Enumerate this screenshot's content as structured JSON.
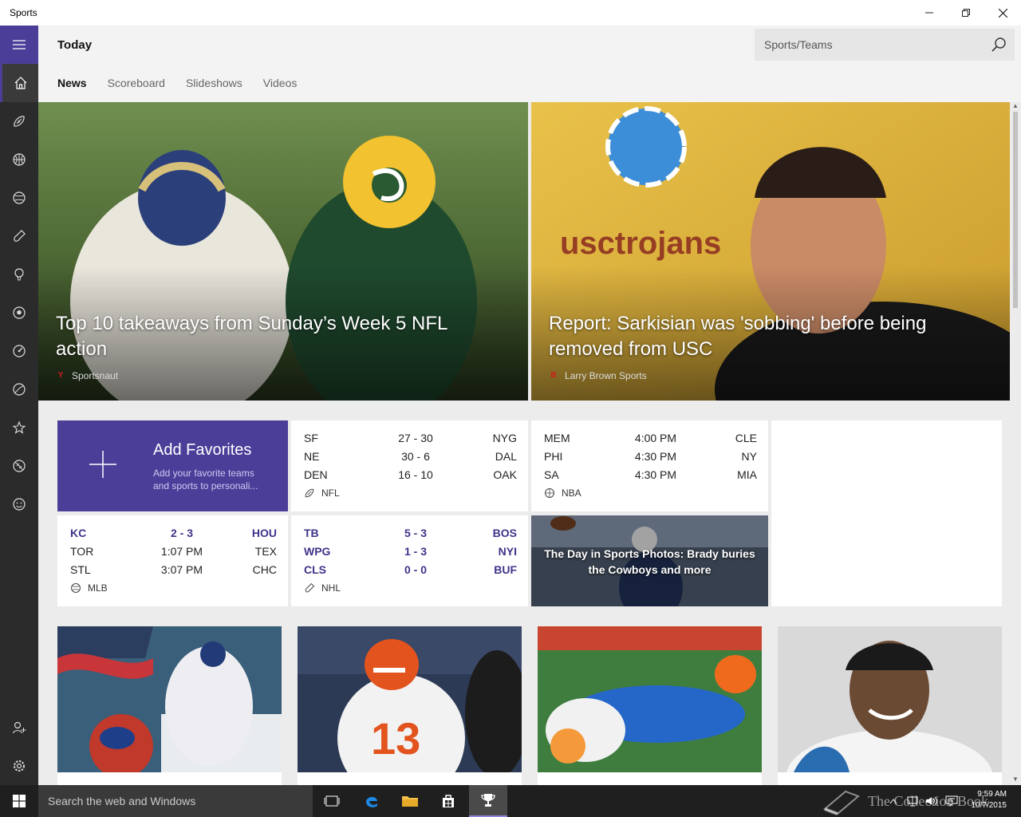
{
  "window": {
    "title": "Sports"
  },
  "header": {
    "page_title": "Today",
    "search_placeholder": "Sports/Teams",
    "tabs": [
      {
        "label": "News",
        "active": true
      },
      {
        "label": "Scoreboard",
        "active": false
      },
      {
        "label": "Slideshows",
        "active": false
      },
      {
        "label": "Videos",
        "active": false
      }
    ]
  },
  "rail": {
    "items": [
      "home-icon",
      "football-icon",
      "basketball-icon",
      "baseball-icon",
      "hockey-icon",
      "golf-icon",
      "soccer-icon",
      "racing-icon",
      "tennis-icon",
      "favorites-icon",
      "rugby-icon",
      "fantasy-icon"
    ],
    "bottom": [
      "add-person-icon",
      "gear-icon"
    ]
  },
  "heroes": [
    {
      "headline": "Top 10 takeaways from Sunday’s Week 5 NFL action",
      "source": "Sportsnaut",
      "source_logo": "Y"
    },
    {
      "headline": "Report: Sarkisian was 'sobbing' before being removed from USC",
      "source": "Larry Brown Sports",
      "source_logo": "B"
    }
  ],
  "favorites": {
    "title": "Add Favorites",
    "subtitle": "Add your favorite teams and sports to personali..."
  },
  "scores": {
    "nfl": {
      "league": "NFL",
      "games": [
        {
          "t1": "SF",
          "mid": "27  -  30",
          "t2": "NYG"
        },
        {
          "t1": "NE",
          "mid": "30  -  6",
          "t2": "DAL"
        },
        {
          "t1": "DEN",
          "mid": "16  -  10",
          "t2": "OAK"
        }
      ]
    },
    "nba": {
      "league": "NBA",
      "games": [
        {
          "t1": "MEM",
          "mid": "4:00 PM",
          "t2": "CLE"
        },
        {
          "t1": "PHI",
          "mid": "4:30 PM",
          "t2": "NY"
        },
        {
          "t1": "SA",
          "mid": "4:30 PM",
          "t2": "MIA"
        }
      ]
    },
    "mlb": {
      "league": "MLB",
      "games": [
        {
          "t1": "KC",
          "mid": "2  -  3",
          "t2": "HOU",
          "live": true
        },
        {
          "t1": "TOR",
          "mid": "1:07 PM",
          "t2": "TEX"
        },
        {
          "t1": "STL",
          "mid": "3:07 PM",
          "t2": "CHC"
        }
      ]
    },
    "nhl": {
      "league": "NHL",
      "games": [
        {
          "t1": "TB",
          "mid": "5  -  3",
          "t2": "BOS",
          "live": true
        },
        {
          "t1": "WPG",
          "mid": "1  -  3",
          "t2": "NYI",
          "live": true
        },
        {
          "t1": "CLS",
          "mid": "0  -  0",
          "t2": "BUF",
          "live": true
        }
      ]
    }
  },
  "photo_card": {
    "caption": "The Day in Sports Photos: Brady buries the Cowboys and more"
  },
  "taskbar": {
    "search_placeholder": "Search the web and Windows",
    "time": "9:59 AM",
    "date": "10/7/2015",
    "watermark": "The Collection Book"
  },
  "colors": {
    "accent": "#4b3e99",
    "rail": "#2b2b2b",
    "live_score": "#3e348a"
  }
}
